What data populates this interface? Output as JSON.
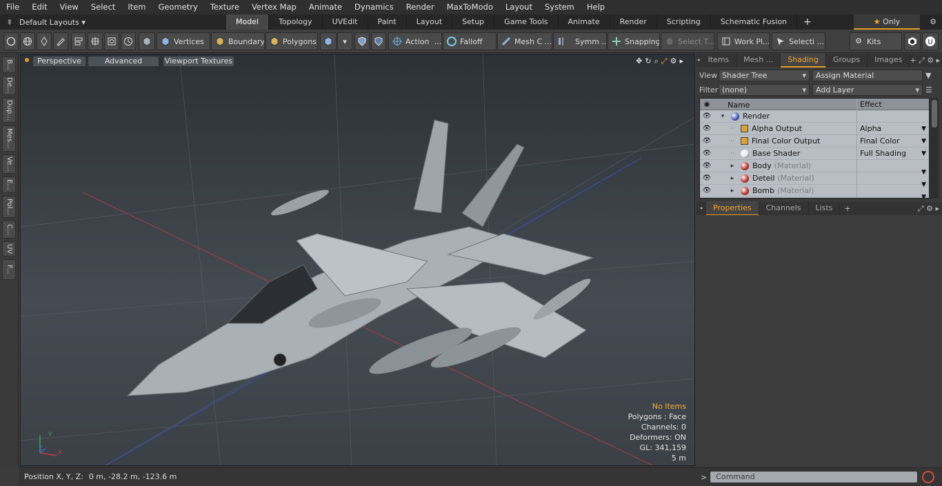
{
  "menu": [
    "File",
    "Edit",
    "View",
    "Select",
    "Item",
    "Geometry",
    "Texture",
    "Vertex Map",
    "Animate",
    "Dynamics",
    "Render",
    "MaxToModo",
    "Layout",
    "System",
    "Help"
  ],
  "layoutbar": {
    "layouts_label": "Default Layouts",
    "tabs": [
      "Model",
      "Topology",
      "UVEdit",
      "Paint",
      "Layout",
      "Setup",
      "Game Tools",
      "Animate",
      "Render",
      "Scripting",
      "Schematic Fusion"
    ],
    "plus": "+",
    "only_label": "Only"
  },
  "toolbar": {
    "vertices": "Vertices",
    "boundary": "Boundary",
    "polygons": "Polygons",
    "action": "Action",
    "falloff": "Falloff",
    "mesh_c": "Mesh C ...",
    "symm": "Symm ...",
    "snapping": "Snapping",
    "select_t": "Select T...",
    "work_pl": "Work Pl...",
    "selecti": "Selecti ...",
    "kits": "Kits"
  },
  "left_strip": [
    "B...",
    "De...",
    "Dup...",
    "Mes...",
    "Ve...",
    "E...",
    "Pol...",
    "C...",
    "UV",
    "F..."
  ],
  "viewport": {
    "view_mode": "Perspective",
    "shading_mode": "Advanced",
    "textures_label": "Viewport Textures",
    "info": {
      "items": "No Items",
      "polygons": "Polygons : Face",
      "channels": "Channels: 0",
      "deformers": "Deformers: ON",
      "gl": "GL: 341,159",
      "scale": "5 m"
    },
    "axis_labels": {
      "x": "X",
      "y": "Y",
      "z": "Z"
    }
  },
  "status": {
    "position_label": "Position X, Y, Z:",
    "position_value": "0 m, -28.2 m, -123.6 m"
  },
  "right_panel": {
    "top_tabs": [
      "Items",
      "Mesh ...",
      "Shading",
      "Groups",
      "Images"
    ],
    "active_top_tab": "Shading",
    "view_label": "View",
    "view_value": "Shader Tree",
    "assign_material": "Assign Material",
    "filter_label": "Filter",
    "filter_value": "(none)",
    "add_layer": "Add Layer",
    "columns": {
      "name": "Name",
      "effect": "Effect"
    },
    "rows": [
      {
        "name": "Render",
        "sub": "",
        "effect": "",
        "indent": 0,
        "ball": "#4a5fc0"
      },
      {
        "name": "Alpha Output",
        "sub": "",
        "effect": "Alpha",
        "indent": 1,
        "ball": ""
      },
      {
        "name": "Final Color Output",
        "sub": "",
        "effect": "Final Color",
        "indent": 1,
        "ball": ""
      },
      {
        "name": "Base Shader",
        "sub": "",
        "effect": "Full Shading",
        "indent": 1,
        "ball": "#e8e8e8"
      },
      {
        "name": "Body",
        "sub": "(Material)",
        "effect": "",
        "indent": 1,
        "ball": "#c23a30"
      },
      {
        "name": "Deteil",
        "sub": "(Material)",
        "effect": "",
        "indent": 1,
        "ball": "#c23a30"
      },
      {
        "name": "Bomb",
        "sub": "(Material)",
        "effect": "",
        "indent": 1,
        "ball": "#c23a30"
      }
    ],
    "bottom_tabs": [
      "Properties",
      "Channels",
      "Lists"
    ],
    "active_bottom_tab": "Properties",
    "command_placeholder": "Command",
    "command_prompt": ">"
  },
  "colors": {
    "accent": "#e69b22",
    "active_tab_text": "#f6a52a"
  }
}
